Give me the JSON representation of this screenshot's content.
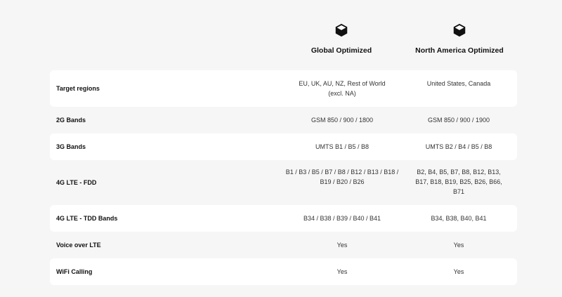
{
  "columns": [
    {
      "title": "Global Optimized",
      "icon": "cube-icon"
    },
    {
      "title": "North America Optimized",
      "icon": "cube-icon"
    }
  ],
  "rows": [
    {
      "label": "Target regions",
      "values": [
        "EU, UK, AU, NZ, Rest of World (excl. NA)",
        "United States, Canada"
      ]
    },
    {
      "label": "2G Bands",
      "values": [
        "GSM 850 / 900 / 1800",
        "GSM 850 / 900 / 1900"
      ]
    },
    {
      "label": "3G Bands",
      "values": [
        "UMTS B1 / B5 / B8",
        "UMTS B2 / B4 / B5 / B8"
      ]
    },
    {
      "label": "4G LTE - FDD",
      "values": [
        "B1 / B3 / B5 / B7 / B8 / B12 / B13 / B18 / B19 / B20 / B26",
        "B2, B4, B5, B7, B8, B12, B13, B17, B18, B19, B25, B26, B66, B71"
      ]
    },
    {
      "label": "4G LTE - TDD Bands",
      "values": [
        "B34 / B38 / B39 / B40 / B41",
        "B34, B38, B40, B41"
      ]
    },
    {
      "label": "Voice over LTE",
      "values": [
        "Yes",
        "Yes"
      ]
    },
    {
      "label": "WiFi Calling",
      "values": [
        "Yes",
        "Yes"
      ]
    }
  ]
}
